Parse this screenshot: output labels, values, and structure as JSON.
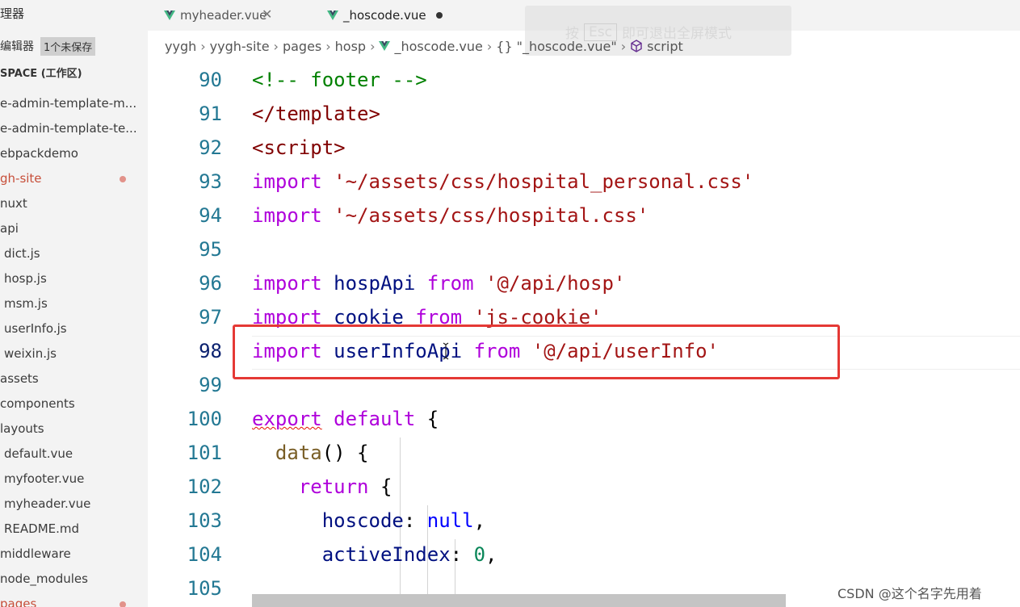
{
  "sidebar": {
    "title": "理器",
    "open_editors": "编辑器",
    "unsaved": "1个未保存",
    "workspace": "SPACE (工作区)",
    "items": [
      {
        "label": "e-admin-template-m..."
      },
      {
        "label": "e-admin-template-te..."
      },
      {
        "label": "ebpackdemo"
      },
      {
        "label": "gh-site"
      },
      {
        "label": "nuxt"
      },
      {
        "label": "api"
      },
      {
        "label": "dict.js"
      },
      {
        "label": "hosp.js"
      },
      {
        "label": "msm.js"
      },
      {
        "label": "userInfo.js"
      },
      {
        "label": "weixin.js"
      },
      {
        "label": "assets"
      },
      {
        "label": "components"
      },
      {
        "label": "layouts"
      },
      {
        "label": "default.vue"
      },
      {
        "label": "myfooter.vue"
      },
      {
        "label": "myheader.vue"
      },
      {
        "label": "README.md"
      },
      {
        "label": "middleware"
      },
      {
        "label": "node_modules"
      },
      {
        "label": "pages"
      }
    ]
  },
  "tabs": [
    {
      "label": "myheader.vue"
    },
    {
      "label": "_hoscode.vue"
    }
  ],
  "fullscreen_hint": {
    "before": "按",
    "key": "Esc",
    "after": "即可退出全屏模式"
  },
  "breadcrumb": {
    "parts": [
      "yygh",
      "yygh-site",
      "pages",
      "hosp",
      "_hoscode.vue",
      "\"_hoscode.vue\"",
      "script"
    ],
    "obj_icon": "{}"
  },
  "editor": {
    "lines": [
      {
        "n": "90"
      },
      {
        "n": "91"
      },
      {
        "n": "92"
      },
      {
        "n": "93"
      },
      {
        "n": "94"
      },
      {
        "n": "95"
      },
      {
        "n": "96"
      },
      {
        "n": "97"
      },
      {
        "n": "98"
      },
      {
        "n": "99"
      },
      {
        "n": "100"
      },
      {
        "n": "101"
      },
      {
        "n": "102"
      },
      {
        "n": "103"
      },
      {
        "n": "104"
      },
      {
        "n": "105"
      }
    ],
    "tokens": {
      "l90": "<!-- footer -->",
      "l91": "</template>",
      "l92": "<script>",
      "l93_kw": "import",
      "l93_str": "'~/assets/css/hospital_personal.css'",
      "l94_kw": "import",
      "l94_str": "'~/assets/css/hospital.css'",
      "l96_kw": "import",
      "l96_id": "hospApi",
      "l96_from": "from",
      "l96_str": "'@/api/hosp'",
      "l97_kw": "import",
      "l97_id": "cookie",
      "l97_from": "from",
      "l97_str": "'js-cookie'",
      "l98_kw": "import",
      "l98_id": "userInfoApi",
      "l98_from": "from",
      "l98_str": "'@/api/userInfo'",
      "l100_export": "export",
      "l100_default": "default",
      "l100_brace": "{",
      "l101_fn": "data",
      "l101_rest": "() {",
      "l102_kw": "return",
      "l102_brace": "{",
      "l103_id": "hoscode",
      "l103_colon": ":",
      "l103_null": "null",
      "l103_comma": ",",
      "l104_id": "activeIndex",
      "l104_colon": ":",
      "l104_num": "0",
      "l104_comma": ","
    }
  },
  "watermark": "CSDN @这个名字先用着"
}
